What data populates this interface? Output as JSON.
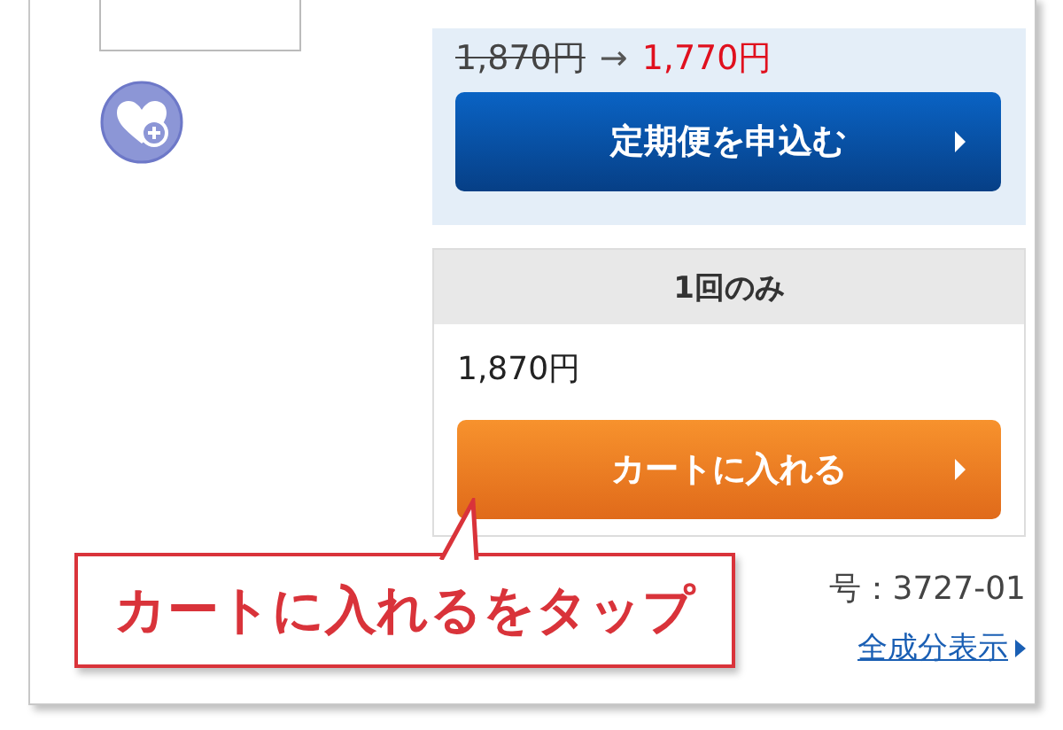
{
  "subscription": {
    "old_price": "1,870円",
    "arrow": "→",
    "new_price": "1,770円",
    "button": "定期便を申込む"
  },
  "one_time": {
    "header": "1回のみ",
    "price": "1,870円",
    "button": "カートに入れる"
  },
  "product_code": "号：3727-01",
  "ingredients_link": "全成分表示",
  "callout": "カートに入れるをタップ"
}
